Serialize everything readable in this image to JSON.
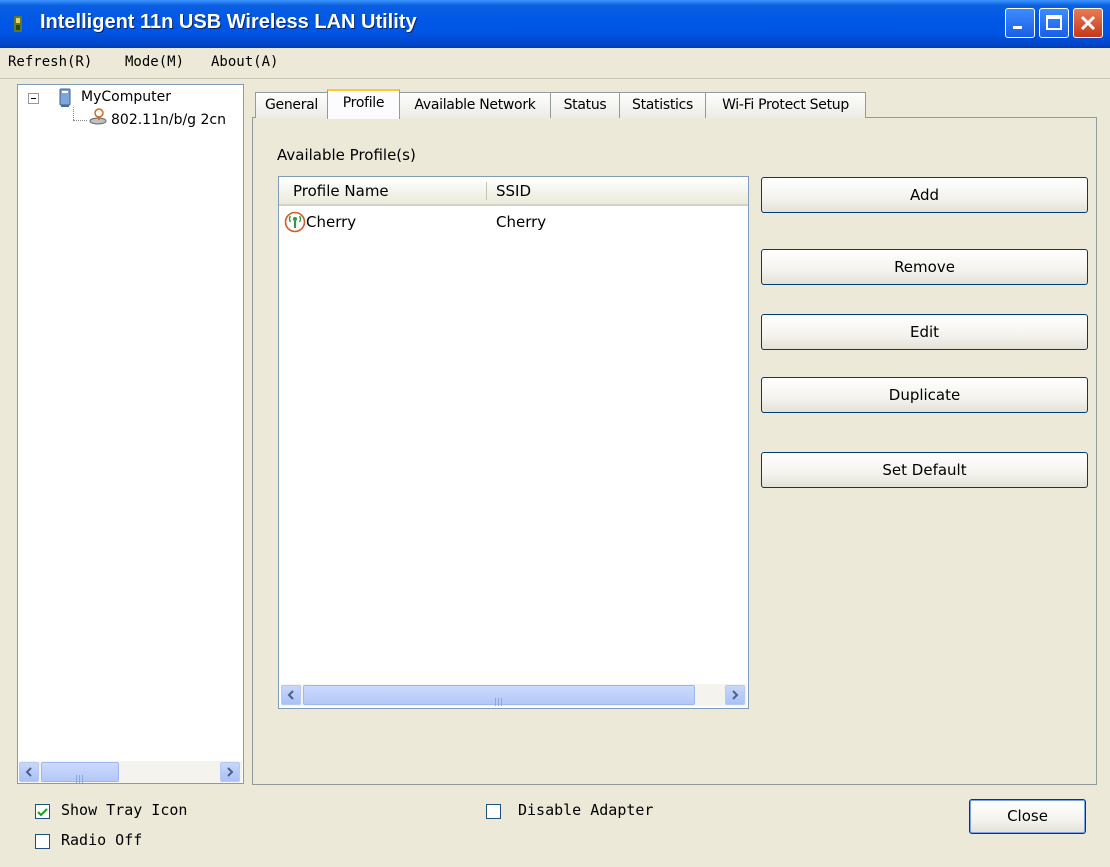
{
  "window": {
    "title": "Intelligent 11n USB Wireless LAN Utility"
  },
  "menu": [
    "Refresh(R)",
    "Mode(M)",
    "About(A)"
  ],
  "tree": {
    "root_label": "MyComputer",
    "adapter_label": "802.11n/b/g 2cn"
  },
  "tabs": [
    {
      "label": "General",
      "active": false
    },
    {
      "label": "Profile",
      "active": true
    },
    {
      "label": "Available Network",
      "active": false
    },
    {
      "label": "Status",
      "active": false
    },
    {
      "label": "Statistics",
      "active": false
    },
    {
      "label": "Wi-Fi Protect Setup",
      "active": false
    }
  ],
  "profile_page": {
    "section_label": "Available Profile(s)",
    "columns": [
      "Profile Name",
      "SSID"
    ],
    "rows": [
      {
        "profile_name": "Cherry",
        "ssid": "Cherry"
      }
    ],
    "buttons": {
      "add": "Add",
      "remove": "Remove",
      "edit": "Edit",
      "duplicate": "Duplicate",
      "set_default": "Set Default"
    }
  },
  "bottom": {
    "show_tray_icon": {
      "label": "Show Tray Icon",
      "checked": true
    },
    "radio_off": {
      "label": "Radio Off",
      "checked": false
    },
    "disable_adapter": {
      "label": "Disable Adapter",
      "checked": false
    },
    "close": "Close"
  },
  "colors": {
    "titlebar": "#0054e3",
    "face": "#ece9d8",
    "active_tab_accent": "#ffc83c",
    "check": "#21a121"
  },
  "icons": {
    "app": "wireless-app-icon",
    "computer": "computer-icon",
    "adapter": "wireless-adapter-icon",
    "profile": "wireless-profile-icon",
    "minimize": "minimize-icon",
    "maximize": "maximize-icon",
    "close": "close-icon"
  }
}
